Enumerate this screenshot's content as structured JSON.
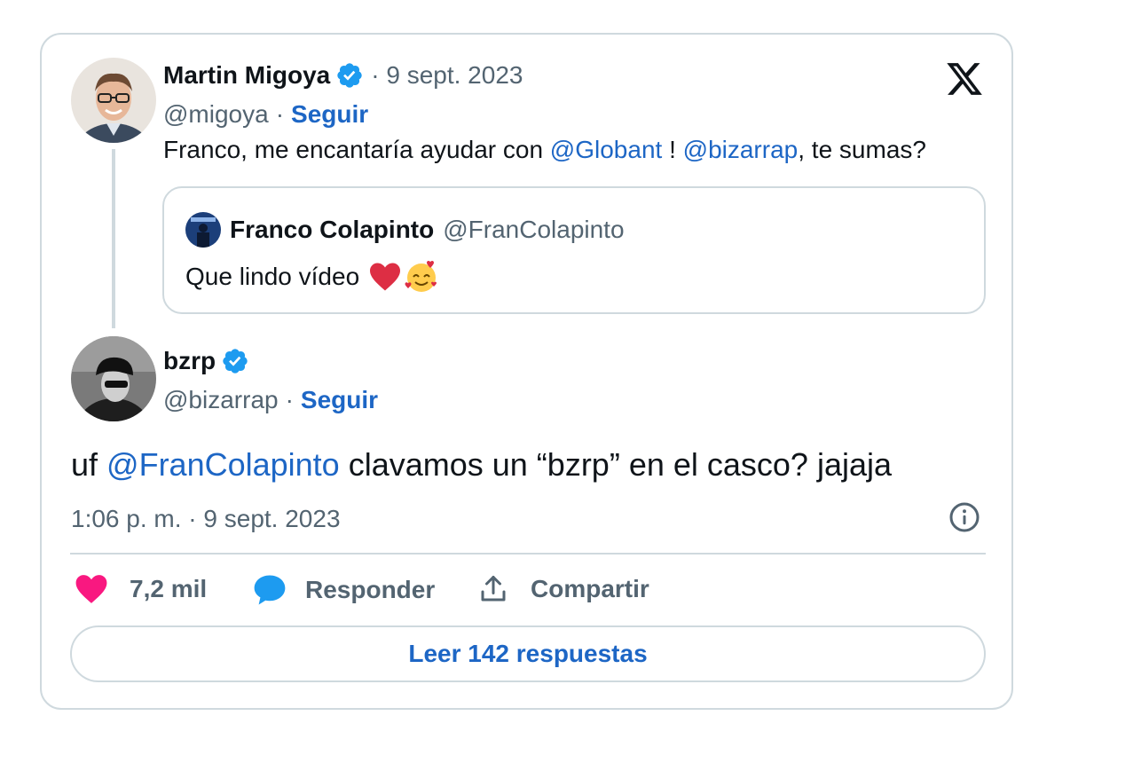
{
  "parent_tweet": {
    "author_name": "Martin Migoya",
    "separator_date": "· 9 sept. 2023",
    "handle": "@migoya",
    "dot": "·",
    "follow_label": "Seguir",
    "text_before": "Franco, me encantaría ayudar con ",
    "mention1": "@Globant",
    "text_middle": " ! ",
    "mention2": "@bizarrap",
    "text_after": ", te sumas?"
  },
  "quoted_tweet": {
    "author_name": "Franco Colapinto",
    "handle": "@FranColapinto",
    "text": "Que lindo vídeo"
  },
  "main_tweet": {
    "author_name": "bzrp",
    "handle": "@bizarrap",
    "dot": "·",
    "follow_label": "Seguir",
    "text_before": "uf ",
    "mention": "@FranColapinto",
    "text_after": " clavamos un “bzrp” en el casco? jajaja",
    "timestamp": "1:06 p. m. · 9 sept. 2023"
  },
  "actions": {
    "likes": "7,2 mil",
    "reply_label": "Responder",
    "share_label": "Compartir"
  },
  "read_replies_label": "Leer 142 respuestas",
  "icons": [
    "x-logo-icon",
    "verified-badge-icon",
    "info-icon",
    "heart-icon",
    "reply-bubble-icon",
    "share-icon",
    "heart-emoji-icon",
    "smiling-hearts-emoji-icon"
  ],
  "colors": {
    "accent_link": "#1d66c5",
    "verified": "#1d9bf0",
    "like_heart": "#f91880",
    "muted_text": "#536471",
    "border": "#cfd9de"
  }
}
